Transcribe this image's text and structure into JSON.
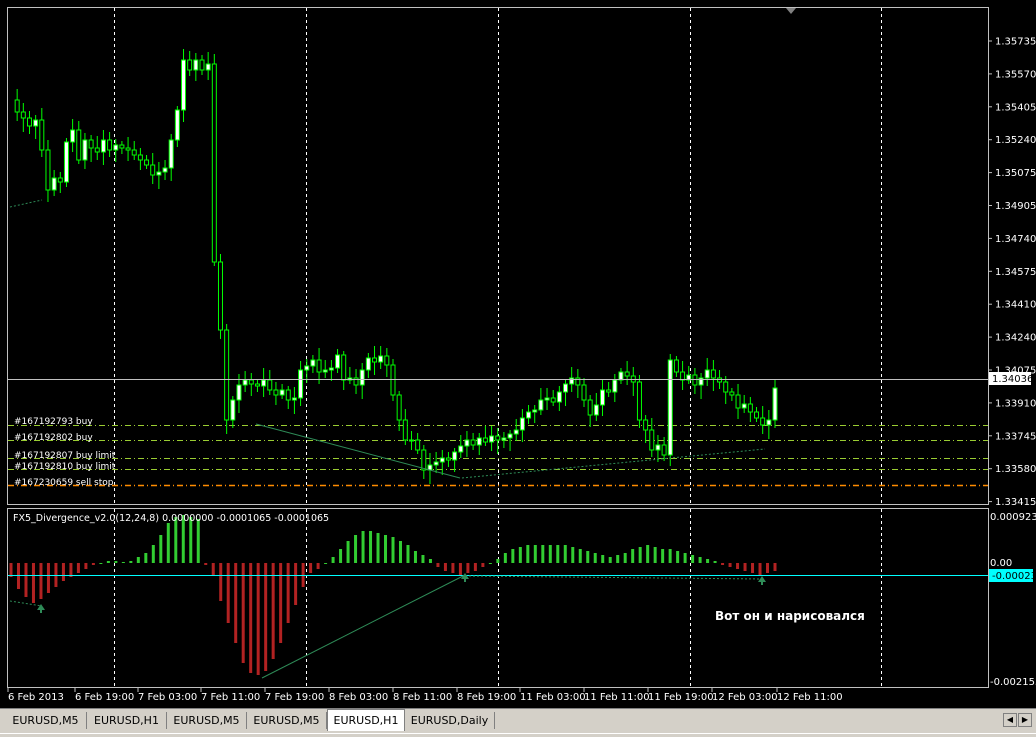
{
  "price_axis": {
    "labels": [
      "1.35735",
      "1.35570",
      "1.35405",
      "1.35240",
      "1.35075",
      "1.34905",
      "1.34740",
      "1.34575",
      "1.34410",
      "1.34240",
      "1.34075",
      "1.33910",
      "1.33745",
      "1.33580",
      "1.33415"
    ],
    "current_price": "1.34036"
  },
  "orders": [
    {
      "label": "#167192793 buy",
      "color": "#9acd32"
    },
    {
      "label": "#167192802 buy",
      "color": "#9acd32"
    },
    {
      "label": "#167192807 buy limit",
      "color": "#9acd32"
    },
    {
      "label": "#167192810 buy limit",
      "color": "#9acd32"
    },
    {
      "label": "#167230659 sell stop",
      "color": "#ff8c00"
    }
  ],
  "indicator": {
    "title": "FX5_Divergence_v2.0(12,24,8) 0.0000000 -0.0001065 -0.0001065",
    "axis_labels": [
      "0.000923",
      "0.00",
      "-0.002153"
    ],
    "current_value": "-0.00023",
    "annotation": "Вот он и нарисовался"
  },
  "time_axis": [
    "6 Feb 2013",
    "6 Feb 19:00",
    "7 Feb 03:00",
    "7 Feb 11:00",
    "7 Feb 19:00",
    "8 Feb 03:00",
    "8 Feb 11:00",
    "8 Feb 19:00",
    "11 Feb 03:00",
    "11 Feb 11:00",
    "11 Feb 19:00",
    "12 Feb 03:00",
    "12 Feb 11:00"
  ],
  "tabs": [
    {
      "label": "EURUSD,M5",
      "active": false
    },
    {
      "label": "EURUSD,H1",
      "active": false
    },
    {
      "label": "EURUSD,M5",
      "active": false
    },
    {
      "label": "EURUSD,M5",
      "active": false
    },
    {
      "label": "EURUSD,H1",
      "active": true
    },
    {
      "label": "EURUSD,Daily",
      "active": false
    }
  ],
  "colors": {
    "bull_candle": "#ffffff",
    "candle_border": "#00ff00",
    "histogram_pos": "#32cd32",
    "histogram_neg": "#b22222",
    "signal_line": "#00ffff",
    "grid": "#ffffff"
  },
  "icons": {
    "tab_scroll_left": "triangle-left-icon",
    "tab_scroll_right": "triangle-right-icon",
    "chart_shift": "triangle-down-icon",
    "divergence_arrow": "up-arrow-icon"
  }
}
